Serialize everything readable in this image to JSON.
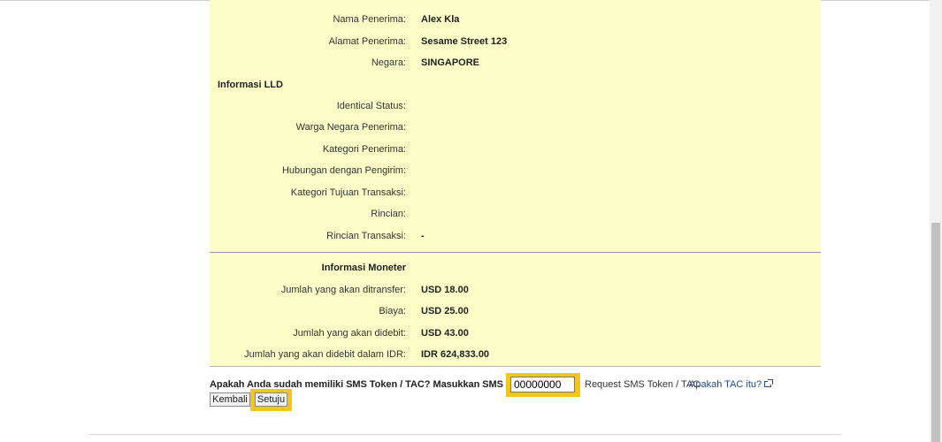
{
  "recipient": {
    "rows": [
      {
        "label": "Nama Penerima:",
        "value": "Alex Kla"
      },
      {
        "label": "Alamat Penerima:",
        "value": "Sesame Street 123"
      },
      {
        "label": "Negara:",
        "value": "SINGAPORE"
      }
    ]
  },
  "lld": {
    "title": "Informasi LLD",
    "rows": [
      {
        "label": "Identical Status:",
        "value": ""
      },
      {
        "label": "Warga Negara Penerima:",
        "value": ""
      },
      {
        "label": "Kategori Penerima:",
        "value": ""
      },
      {
        "label": "Hubungan dengan Pengirim:",
        "value": ""
      },
      {
        "label": "Kategori Tujuan Transaksi:",
        "value": ""
      },
      {
        "label": "Rincian:",
        "value": ""
      },
      {
        "label": "Rincian Transaksi:",
        "value": "-"
      }
    ]
  },
  "monetary": {
    "title": "Informasi Moneter",
    "rows": [
      {
        "label": "Jumlah yang akan ditransfer:",
        "value": "USD 18.00"
      },
      {
        "label": "Biaya:",
        "value": "USD 25.00"
      },
      {
        "label": "Jumlah yang akan didebit:",
        "value": "USD 43.00"
      },
      {
        "label": "Jumlah yang akan didebit dalam IDR:",
        "value": "IDR 624,833.00"
      }
    ]
  },
  "tac": {
    "label": "Apakah Anda sudah memiliki SMS Token / TAC? Masukkan SMS Token / TAC",
    "input_value": "00000000",
    "request_link": "Request SMS Token / TAC",
    "help_link": "Apakah TAC itu?"
  },
  "buttons": {
    "back": "Kembali",
    "agree": "Setuju"
  },
  "colors": {
    "panel_bg": "#fdfdc8",
    "highlight": "#f5c518",
    "link": "#1a4b9c"
  }
}
